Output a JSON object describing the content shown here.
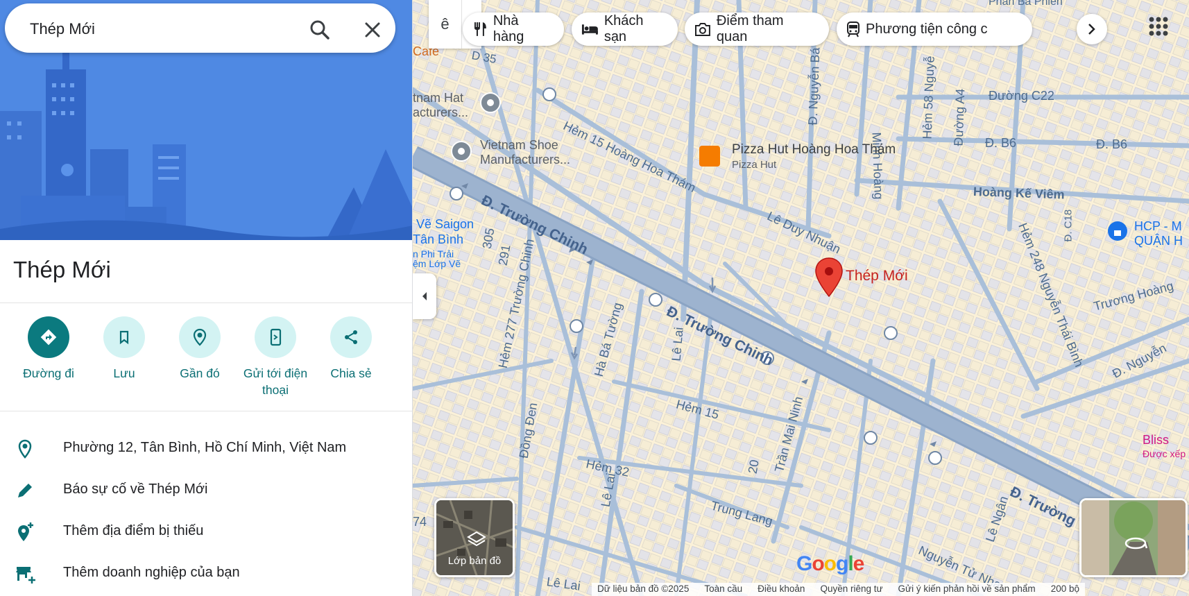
{
  "search": {
    "value": "Thép Mới"
  },
  "place": {
    "title": "Thép Mới"
  },
  "actions": [
    {
      "label": "Đường đi",
      "icon": "directions-icon"
    },
    {
      "label": "Lưu",
      "icon": "bookmark-icon"
    },
    {
      "label": "Gần đó",
      "icon": "nearby-icon"
    },
    {
      "label": "Gửi tới điện thoại",
      "icon": "send-to-phone-icon"
    },
    {
      "label": "Chia sẻ",
      "icon": "share-icon"
    }
  ],
  "info": [
    {
      "text": "Phường 12, Tân Bình, Hồ Chí Minh, Việt Nam",
      "icon": "location-pin-icon"
    },
    {
      "text": "Báo sự cố về Thép Mới",
      "icon": "pencil-icon"
    },
    {
      "text": "Thêm địa điểm bị thiếu",
      "icon": "add-place-icon"
    },
    {
      "text": "Thêm doanh nghiệp của bạn",
      "icon": "add-business-icon"
    }
  ],
  "chips": [
    {
      "label": "Nhà hàng",
      "icon": "restaurant-icon"
    },
    {
      "label": "Khách sạn",
      "icon": "hotel-icon"
    },
    {
      "label": "Điểm tham quan",
      "icon": "camera-icon"
    },
    {
      "label": "Phương tiện công c",
      "icon": "transit-icon"
    }
  ],
  "map": {
    "pin_label": "Thép Mới",
    "layers_label": "Lớp bản đồ",
    "logo": "Google",
    "labels": {
      "truong_chinh_1": "Đ. Trường Chinh",
      "truong_chinh_2": "Đ. Trường Chinh",
      "truong_chinh_3": "Đ. Trường",
      "hem15_hht": "Hẻm 15 Hoàng Hoa Thám",
      "le_duy_nhuan": "Lê Duy Nhuận",
      "hoang_ke_viem": "Hoàng Kế Viêm",
      "duong_c22": "Đường C22",
      "d_b6_1": "Đ. B6",
      "d_b6_2": "Đ. B6",
      "duong_a4": "Đường A4",
      "hem58": "Hẻm 58 Nguyễ",
      "minh_hoang": "Minh Hoàng",
      "nguyen_ba": "Đ. Nguyễn Bá",
      "d_c18": "Đ. C18",
      "hem248": "Hẻm 248 Nguyễn Thái Bình",
      "truong_hoang": "Trương Hoàng",
      "nguyen_r": "Đ. Nguyễn",
      "hem277": "Hẻm 277 Trường Chinh",
      "ha_ba_tuong": "Hà Bá Tường",
      "le_lai_1": "Lê Lai",
      "le_lai_2": "Lê Lai",
      "le_lai_3": "Lê Lai",
      "hem15": "Hẻm 15",
      "hem32": "Hẻm 32",
      "dong_den": "Đồng Đen",
      "tran_mai_ninh": "Trần Mai Ninh",
      "trung_lang": "Trung Lang",
      "nguyen_tu_nha": "Nguyễn Tử Nha",
      "le_ngan": "Lê Ngân",
      "n305": "305",
      "n291": "291",
      "n20": "20",
      "n74": "74",
      "d35": "D 35",
      "cafe": "Cafe",
      "phan_ba_phien": "Phan Bá Phiến",
      "vietnam_hat_1": "tnam Hat",
      "vietnam_hat_2": "acturers...",
      "shoe_1": "Vietnam Shoe",
      "shoe_2": "Manufacturers...",
      "pizza_1": "Pizza Hut Hoàng Hoa Thám",
      "pizza_2": "Pizza Hut",
      "ve_saigon_1": "Vẽ Saigon",
      "ve_saigon_2": "Tân Bình",
      "ve_saigon_3": "n Phi Trải",
      "ve_saigon_4": "ệm Lớp Vẽ",
      "hcp_1": "HCP - M",
      "hcp_2": "QUẬN H",
      "bliss_1": "Bliss",
      "bliss_2": "Được xếp"
    },
    "footer": [
      "Dữ liệu bản đồ ©2025",
      "Toàn cầu",
      "Điều khoản",
      "Quyền riêng tư",
      "Gửi ý kiến phản hồi về sản phẩm",
      "200 bộ"
    ]
  },
  "colors": {
    "accent": "#0b7a7f",
    "hero": "#4d86e0",
    "road_main": "#8fa6c4",
    "road": "#aabfd8",
    "block": "#fbf3dc",
    "pin": "#ea4335"
  }
}
